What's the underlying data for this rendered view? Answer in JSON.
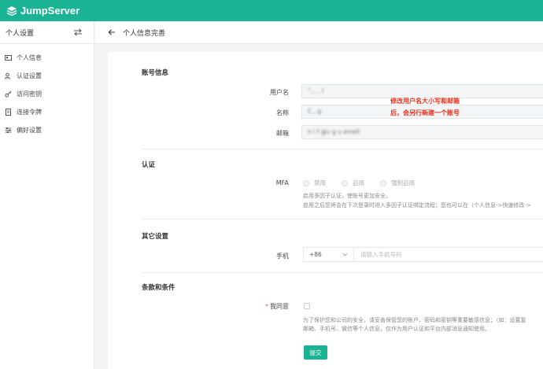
{
  "app": {
    "brand": "JumpServer"
  },
  "sidebar": {
    "title": "个人设置",
    "items": [
      {
        "label": "个人信息",
        "icon": "id-card-icon"
      },
      {
        "label": "认证设置",
        "icon": "user-shield-icon"
      },
      {
        "label": "访问密钥",
        "icon": "key-icon"
      },
      {
        "label": "连接令牌",
        "icon": "token-icon"
      },
      {
        "label": "偏好设置",
        "icon": "sliders-icon"
      }
    ]
  },
  "header": {
    "title": "个人信息完善"
  },
  "account": {
    "section_title": "账号信息",
    "username_label": "用户名",
    "username_value": "\"…  ,  l",
    "name_label": "名称",
    "name_value": "C  ,  g",
    "email_label": "邮箱",
    "email_value": "n  l  f  @v  g  u  emell"
  },
  "annotation": {
    "line1": "修改用户名大小写和邮箱",
    "line2": "后，会另行新建一个账号"
  },
  "auth": {
    "section_title": "认证",
    "mfa_label": "MFA",
    "options": [
      "禁用",
      "启用",
      "强制启用"
    ],
    "help_line1": "启用多因子认证，使账号更加安全。",
    "help_line2": "启用之后您将会在下次登录时进入多因子认证绑定流程；您也可以在（个人信息->快速修改->"
  },
  "other": {
    "section_title": "其它设置",
    "phone_label": "手机",
    "phone_prefix": "+86",
    "phone_placeholder": "请输入手机号码"
  },
  "terms": {
    "section_title": "条款和条件",
    "agree_required": "*",
    "agree_label": "我同意",
    "text_line1": "为了保护您和公司的安全，请妥善保管您的账户、密码和密钥等重要敏感信息；（如：设置复",
    "text_line2": "邮箱、手机号、微信等个人信息，仅作为用户认证和平台内部消息通知使用。",
    "submit_label": "提交"
  },
  "colors": {
    "accent": "#1ab394",
    "annotation": "#e8321e"
  }
}
